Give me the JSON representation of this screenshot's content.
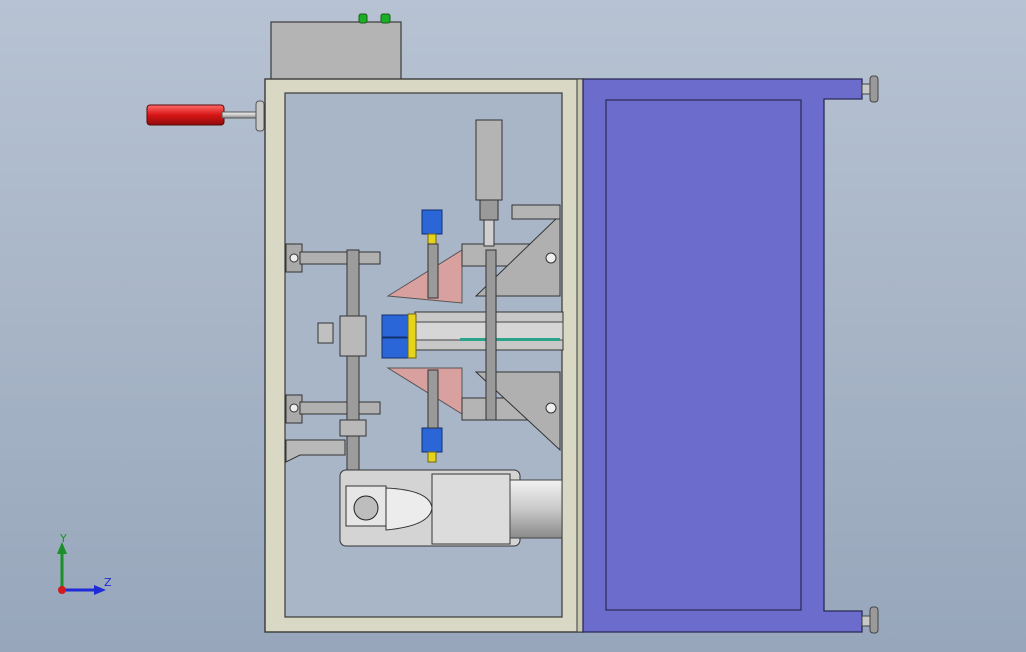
{
  "viewport": {
    "background_top": "#b7c3d3",
    "background_bottom": "#97a6bb"
  },
  "triad": {
    "y_label": "Y",
    "z_label": "Z",
    "y_color": "#1a8f2a",
    "z_color": "#1f2bd6",
    "origin_color": "#d21b1b"
  },
  "colors": {
    "frame": "#d8d8c4",
    "frame_stroke": "#3a3a3a",
    "panel_blue": "#6b6ccc",
    "handle_red": "#d81515",
    "motor_blue": "#2a66d8",
    "pink_block": "#d9a0a0",
    "steel": "#a9a9a9",
    "green_lamp": "#19b026",
    "yellow_part": "#e6d31c"
  }
}
